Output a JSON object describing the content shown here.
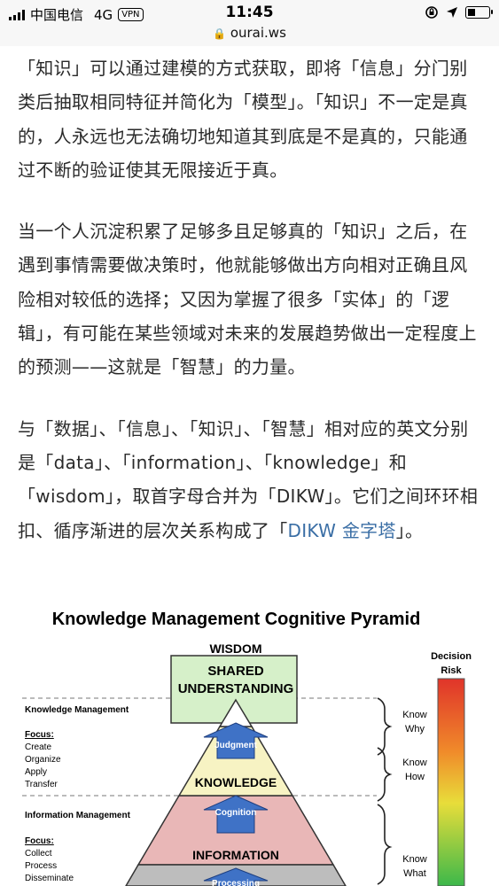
{
  "status_bar": {
    "carrier": "中国电信",
    "network": "4G",
    "vpn": "VPN",
    "time": "11:45",
    "url": "ourai.ws"
  },
  "article": {
    "p1": "「知识」可以通过建模的方式获取，即将「信息」分门别类后抽取相同特征并简化为「模型」。「知识」不一定是真的，人永远也无法确切地知道其到底是不是真的，只能通过不断的验证使其无限接近于真。",
    "p2": "当一个人沉淀积累了足够多且足够真的「知识」之后，在遇到事情需要做决策时，他就能够做出方向相对正确且风险相对较低的选择；又因为掌握了很多「实体」的「逻辑」，有可能在某些领域对未来的发展趋势做出一定程度上的预测——这就是「智慧」的力量。",
    "p3_text": "与「数据」、「信息」、「知识」、「智慧」相对应的英文分别是「data」、「information」、「knowledge」和「wisdom」，取首字母合并为「DIKW」。它们之间环环相扣、循序渐进的层次关系构成了「",
    "p3_link": "DIKW 金字塔",
    "p3_end": "」。"
  },
  "figure": {
    "title": "Knowledge Management Cognitive Pyramid",
    "levels": {
      "wisdom": "WISDOM",
      "shared_1": "SHARED",
      "shared_2": "UNDERSTANDING",
      "knowledge": "KNOWLEDGE",
      "information": "INFORMATION"
    },
    "arrows": {
      "judgment": "Judgment",
      "cognition": "Cognition",
      "processing": "Processing"
    },
    "left": {
      "km_title": "Knowledge Management",
      "focus": "Focus:",
      "km_items": [
        "Create",
        "Organize",
        "Apply",
        "Transfer"
      ],
      "im_title": "Information Management",
      "im_items": [
        "Collect",
        "Process",
        "Disseminate"
      ]
    },
    "right": {
      "know_why_1": "Know",
      "know_why_2": "Why",
      "know_how_1": "Know",
      "know_how_2": "How",
      "know_what_1": "Know",
      "know_what_2": "What",
      "risk_1": "Decision",
      "risk_2": "Risk"
    }
  }
}
